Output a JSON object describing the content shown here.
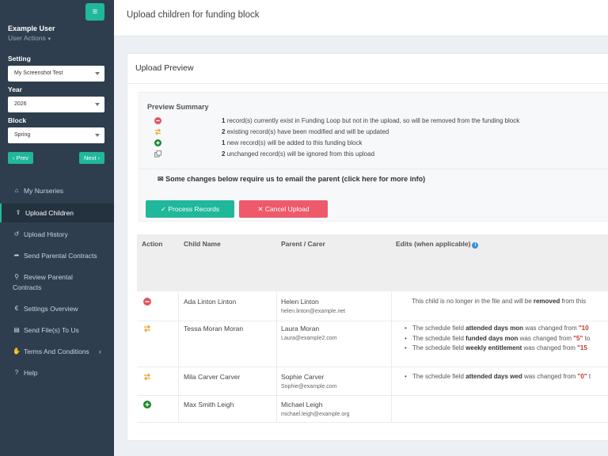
{
  "sidebar": {
    "menu_icon": "hamburger-icon",
    "user_name": "Example User",
    "user_actions": "User Actions",
    "setting_label": "Setting",
    "setting_value": "My Screenshot Test",
    "year_label": "Year",
    "year_value": "2026",
    "block_label": "Block",
    "block_value": "Spring",
    "prev_label": "Prev",
    "next_label": "Next",
    "items": [
      {
        "label": "My Nurseries",
        "icon": "home-icon"
      },
      {
        "label": "Upload Children",
        "icon": "user-upload-icon"
      },
      {
        "label": "Upload History",
        "icon": "history-icon"
      },
      {
        "label": "Send Parental Contracts",
        "icon": "share-icon"
      },
      {
        "label": "Review Parental",
        "label2": "Contracts",
        "icon": "search-icon"
      },
      {
        "label": "Settings Overview",
        "icon": "euro-icon"
      },
      {
        "label": "Send File(s) To Us",
        "icon": "file-icon"
      },
      {
        "label": "Terms And Conditions",
        "icon": "handshake-icon"
      },
      {
        "label": "Help",
        "icon": "question-icon"
      }
    ]
  },
  "header": {
    "title": "Upload children for funding block"
  },
  "panel": {
    "title": "Upload Preview",
    "summary_title": "Preview Summary",
    "summary": [
      {
        "count": "1",
        "text": "record(s) currently exist in Funding Loop but not in the upload, so will be removed from the funding block"
      },
      {
        "count": "2",
        "text": "existing record(s) have been modified and will be updated"
      },
      {
        "count": "1",
        "text": "new record(s) will be added to this funding block"
      },
      {
        "count": "2",
        "text": "unchanged record(s) will be ignored from this upload"
      }
    ],
    "email_note": "Some changes below require us to email the parent (click here for more info)",
    "process_button": "Process Records",
    "cancel_button": "Cancel Upload"
  },
  "table": {
    "headers": [
      "Action",
      "Child Name",
      "Parent / Carer",
      "Edits (when applicable)"
    ],
    "rows": [
      {
        "action": "remove",
        "child": "Ada Linton Linton",
        "parent": "Helen Linton",
        "email": "helen.linton@example.net",
        "edit_pre": "This child is no longer in the file and will be ",
        "edit_bold": "removed",
        "edit_post": " from this"
      },
      {
        "action": "modify",
        "child": "Tessa Moran Moran",
        "parent": "Laura Moran",
        "email": "Laura@example2.com",
        "edits": [
          {
            "pre": "The schedule field ",
            "field": "attended days mon",
            "mid": " was changed from ",
            "val": "\"10"
          },
          {
            "pre": "The schedule field ",
            "field": "funded days mon",
            "mid": " was changed from ",
            "val": "\"5\"",
            "post": " to"
          },
          {
            "pre": "The schedule field ",
            "field": "weekly entitlement",
            "mid": " was changed from ",
            "val": "\"15"
          }
        ]
      },
      {
        "action": "modify",
        "child": "Mila Carver Carver",
        "parent": "Sophie Carver",
        "email": "Sophie@example.com",
        "edits": [
          {
            "pre": "The schedule field ",
            "field": "attended days wed",
            "mid": " was changed from ",
            "val": "\"0\"",
            "post": " t"
          }
        ]
      },
      {
        "action": "add",
        "child": "Max Smith Leigh",
        "parent": "Michael Leigh",
        "email": "michael.leigh@example.org"
      }
    ]
  },
  "colors": {
    "accent": "#1fb89a",
    "danger": "#ee5a6b",
    "sidebar": "#2e3e4e",
    "warning": "#f0a030",
    "success": "#1a8a2e"
  }
}
